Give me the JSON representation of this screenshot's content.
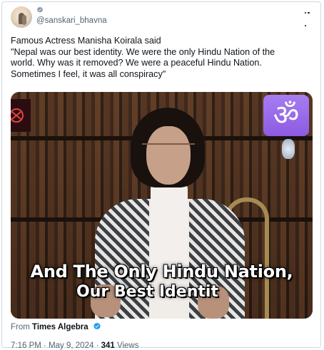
{
  "post": {
    "author_handle": "@sanskari_bhavna",
    "text_lines": [
      "Famous Actress Manisha Koirala said",
      "\"Nepal was our best identity. We were the only Hindu Nation of the",
      "world. Why was it removed? We were a peaceful Hindu Nation.",
      "Sometimes I feel, it was all conspiracy\""
    ]
  },
  "media": {
    "overlay_symbol": "ॐ",
    "caption_line1": "And The Only Hindu Nation,",
    "caption_line2": "Our Best Identit"
  },
  "source": {
    "prefix": "From",
    "name": "Times Algebra"
  },
  "meta": {
    "time": "7:16 PM",
    "separator": "·",
    "date": "May 9, 2024",
    "views_count": "341",
    "views_label": "Views"
  },
  "colors": {
    "verified_gray": "#829aab",
    "verified_blue": "#1d9bf0",
    "secondary_text": "#536471",
    "primary_text": "#0f1419",
    "om_badge": "#9b6cea"
  },
  "icons": [
    "avatar",
    "verified-badge-gray",
    "more-icon",
    "om-badge",
    "verified-badge-blue"
  ]
}
